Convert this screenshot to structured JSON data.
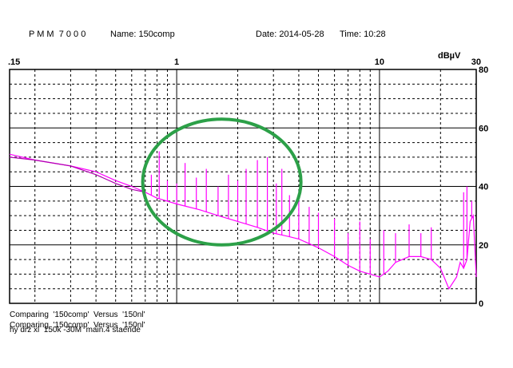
{
  "header": {
    "instrument": "P M M  7 0 0 0",
    "name": "Name: 150comp",
    "date": "Date: 2014-05-28",
    "time": "Time: 10:28"
  },
  "footer": {
    "line1": "Comparing  '150comp'  Versus  '150nl'",
    "line2": "Comparing  '150comp'  Versus  '150nl'",
    "line3": "hy drz xl  150k -30M  main.4 staende"
  },
  "colors": {
    "trace": "#ff00ff",
    "trace_ref": "#b000b0",
    "highlight": "#2ca048",
    "grid": "#000000"
  },
  "chart_data": {
    "type": "line",
    "xscale": "log",
    "xlim": [
      0.15,
      30
    ],
    "ylim": [
      0,
      80
    ],
    "x_tick_labels": [
      {
        "v": 0.15,
        "label": ".15"
      },
      {
        "v": 1,
        "label": "1"
      },
      {
        "v": 10,
        "label": "10"
      },
      {
        "v": 30,
        "label": "30"
      }
    ],
    "y_tick_labels": [
      {
        "v": 80,
        "label": "80"
      },
      {
        "v": 60,
        "label": "60"
      },
      {
        "v": 40,
        "label": "40"
      },
      {
        "v": 20,
        "label": "20"
      },
      {
        "v": 0,
        "label": "0"
      }
    ],
    "ylabel": "dBµV",
    "grid": true,
    "series": [
      {
        "role": "measured",
        "color": "#ff00ff",
        "x": [
          0.15,
          0.2,
          0.3,
          0.4,
          0.5,
          0.6,
          0.7,
          0.8,
          1.0,
          1.3,
          1.6,
          2.0,
          2.5,
          3.0,
          3.5,
          4.0,
          5.0,
          6.0,
          7.0,
          8.0,
          9.0,
          10.0,
          11.0,
          12.0,
          14.0,
          16.0,
          18.0,
          20.0,
          22.0,
          24.0,
          25.0,
          26.0,
          27.0,
          28.0,
          29.0,
          30.0
        ],
        "y": [
          51,
          49,
          47,
          45,
          42,
          40,
          38,
          36,
          34,
          32,
          30,
          28,
          26,
          24,
          23,
          22,
          19,
          16,
          13,
          11,
          10,
          9,
          11,
          14,
          16,
          16,
          15,
          12,
          5,
          9,
          14,
          12,
          15,
          28,
          30,
          9
        ]
      },
      {
        "role": "reference",
        "color": "#b000b0",
        "x": [
          0.15,
          0.2,
          0.3,
          0.4,
          0.5,
          0.6,
          0.7
        ],
        "y": [
          50,
          49,
          47,
          44,
          41,
          39,
          38
        ]
      }
    ],
    "spikes": [
      {
        "x": 0.75,
        "y": 44
      },
      {
        "x": 0.82,
        "y": 52
      },
      {
        "x": 0.9,
        "y": 42
      },
      {
        "x": 1.0,
        "y": 41
      },
      {
        "x": 1.1,
        "y": 48
      },
      {
        "x": 1.25,
        "y": 43
      },
      {
        "x": 1.4,
        "y": 46
      },
      {
        "x": 1.6,
        "y": 40
      },
      {
        "x": 1.8,
        "y": 44
      },
      {
        "x": 2.0,
        "y": 42
      },
      {
        "x": 2.2,
        "y": 46
      },
      {
        "x": 2.5,
        "y": 49
      },
      {
        "x": 2.8,
        "y": 50
      },
      {
        "x": 3.1,
        "y": 41
      },
      {
        "x": 3.3,
        "y": 46
      },
      {
        "x": 3.6,
        "y": 37
      },
      {
        "x": 4.0,
        "y": 37
      },
      {
        "x": 4.5,
        "y": 33
      },
      {
        "x": 5.0,
        "y": 31
      },
      {
        "x": 6.0,
        "y": 29
      },
      {
        "x": 7.0,
        "y": 24
      },
      {
        "x": 8.0,
        "y": 28
      },
      {
        "x": 9.0,
        "y": 22
      },
      {
        "x": 10.5,
        "y": 25
      },
      {
        "x": 12.0,
        "y": 24
      },
      {
        "x": 14.0,
        "y": 27
      },
      {
        "x": 16.0,
        "y": 24
      },
      {
        "x": 18.0,
        "y": 26
      },
      {
        "x": 26.0,
        "y": 38
      },
      {
        "x": 27.0,
        "y": 40
      },
      {
        "x": 28.5,
        "y": 35
      }
    ],
    "highlight_ellipse": {
      "x_range": [
        0.68,
        4.1
      ],
      "y_range": [
        20,
        63
      ]
    }
  }
}
